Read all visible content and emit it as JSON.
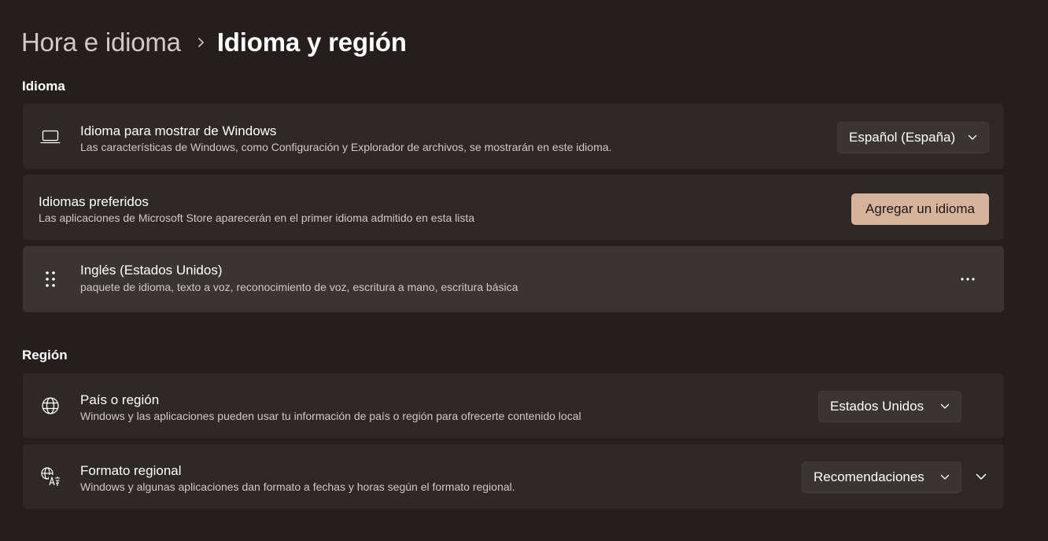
{
  "breadcrumb": {
    "parent": "Hora e idioma",
    "current": "Idioma y región"
  },
  "language_section": {
    "title": "Idioma",
    "display_language": {
      "icon": "laptop-icon",
      "title": "Idioma para mostrar de Windows",
      "description": "Las características de Windows, como Configuración y Explorador de archivos, se mostrarán en este idioma.",
      "selected_value": "Español (España)"
    },
    "preferred_languages": {
      "title": "Idiomas preferidos",
      "description": "Las aplicaciones de Microsoft Store aparecerán en el primer idioma admitido en esta lista",
      "add_button_label": "Agregar un idioma"
    },
    "installed_language": {
      "icon": "drag-handle-icon",
      "title": "Inglés (Estados Unidos)",
      "description": "paquete de idioma, texto a voz, reconocimiento de voz, escritura a mano, escritura básica",
      "more_icon": "more-options-icon"
    }
  },
  "region_section": {
    "title": "Región",
    "country": {
      "icon": "globe-icon",
      "title": "País o región",
      "description": "Windows y las aplicaciones pueden usar tu información de país o región para ofrecerte contenido local",
      "selected_value": "Estados Unidos"
    },
    "regional_format": {
      "icon": "regional-format-icon",
      "title": "Formato regional",
      "description": "Windows y algunas aplicaciones dan formato a fechas y horas según el formato regional.",
      "selected_value": "Recomendaciones"
    }
  },
  "colors": {
    "background": "#241f1d",
    "card": "#2e2927",
    "card_hover": "#3a3432",
    "accent": "#d7b39b"
  }
}
